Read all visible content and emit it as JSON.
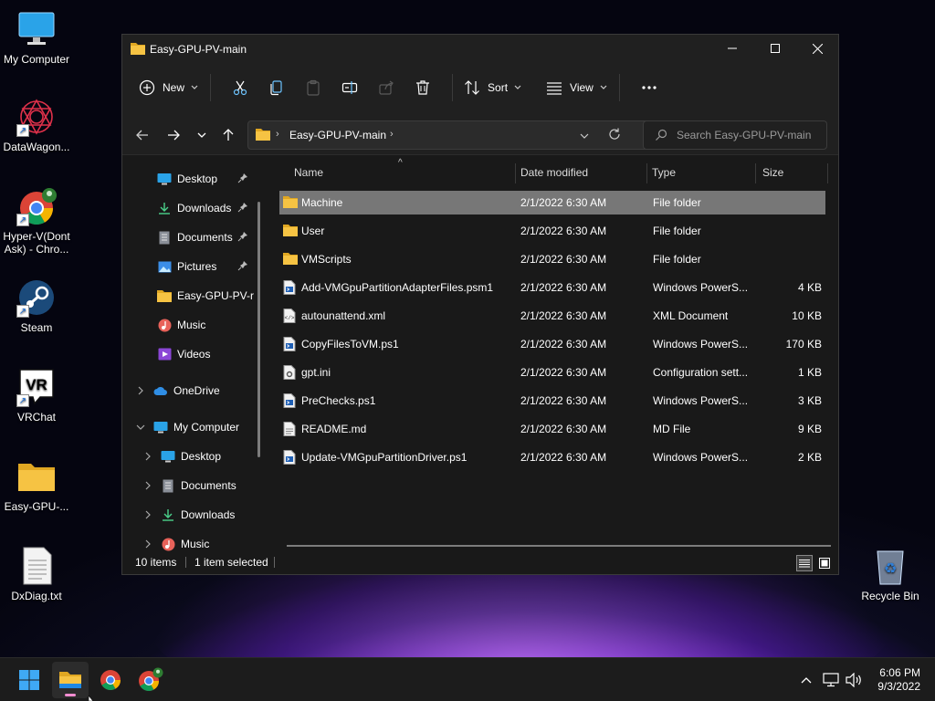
{
  "desktop": {
    "icons": [
      {
        "label": "My Computer"
      },
      {
        "label": "DataWagon..."
      },
      {
        "label": "Hyper-V(Dont Ask) - Chro..."
      },
      {
        "label": "Steam"
      },
      {
        "label": "VRChat"
      },
      {
        "label": "Easy-GPU-..."
      },
      {
        "label": "DxDiag.txt"
      },
      {
        "label": "Recycle Bin"
      }
    ]
  },
  "window": {
    "title": "Easy-GPU-PV-main",
    "commands": {
      "new_label": "New",
      "sort_label": "Sort",
      "view_label": "View"
    },
    "address": {
      "crumb": "Easy-GPU-PV-main"
    },
    "search": {
      "placeholder": "Search Easy-GPU-PV-main"
    },
    "sidebar": {
      "items": [
        {
          "label": "Desktop",
          "icon": "desktop-icon",
          "pinned": true
        },
        {
          "label": "Downloads",
          "icon": "download-icon",
          "pinned": true
        },
        {
          "label": "Documents",
          "icon": "document-icon",
          "pinned": true
        },
        {
          "label": "Pictures",
          "icon": "picture-icon",
          "pinned": true
        },
        {
          "label": "Easy-GPU-PV-r",
          "icon": "folder-icon",
          "pinned": false
        },
        {
          "label": "Music",
          "icon": "music-icon",
          "pinned": false
        },
        {
          "label": "Videos",
          "icon": "video-icon",
          "pinned": false
        },
        {
          "label": "OneDrive",
          "icon": "cloud-icon",
          "pinned": false
        },
        {
          "label": "My Computer",
          "icon": "computer-icon",
          "pinned": false
        },
        {
          "label": "Desktop",
          "icon": "desktop-icon",
          "pinned": false
        },
        {
          "label": "Documents",
          "icon": "document-icon",
          "pinned": false
        },
        {
          "label": "Downloads",
          "icon": "download-icon",
          "pinned": false
        },
        {
          "label": "Music",
          "icon": "music-icon",
          "pinned": false
        }
      ]
    },
    "columns": {
      "name": "Name",
      "date": "Date modified",
      "type": "Type",
      "size": "Size"
    },
    "files": [
      {
        "name": "Machine",
        "date": "2/1/2022 6:30 AM",
        "type": "File folder",
        "size": "",
        "icon": "folder-icon",
        "selected": true
      },
      {
        "name": "User",
        "date": "2/1/2022 6:30 AM",
        "type": "File folder",
        "size": "",
        "icon": "folder-icon",
        "selected": false
      },
      {
        "name": "VMScripts",
        "date": "2/1/2022 6:30 AM",
        "type": "File folder",
        "size": "",
        "icon": "folder-icon",
        "selected": false
      },
      {
        "name": "Add-VMGpuPartitionAdapterFiles.psm1",
        "date": "2/1/2022 6:30 AM",
        "type": "Windows PowerS...",
        "size": "4 KB",
        "icon": "script-file-icon",
        "selected": false
      },
      {
        "name": "autounattend.xml",
        "date": "2/1/2022 6:30 AM",
        "type": "XML Document",
        "size": "10 KB",
        "icon": "xml-file-icon",
        "selected": false
      },
      {
        "name": "CopyFilesToVM.ps1",
        "date": "2/1/2022 6:30 AM",
        "type": "Windows PowerS...",
        "size": "170 KB",
        "icon": "script-file-icon",
        "selected": false
      },
      {
        "name": "gpt.ini",
        "date": "2/1/2022 6:30 AM",
        "type": "Configuration sett...",
        "size": "1 KB",
        "icon": "config-file-icon",
        "selected": false
      },
      {
        "name": "PreChecks.ps1",
        "date": "2/1/2022 6:30 AM",
        "type": "Windows PowerS...",
        "size": "3 KB",
        "icon": "script-file-icon",
        "selected": false
      },
      {
        "name": "README.md",
        "date": "2/1/2022 6:30 AM",
        "type": "MD File",
        "size": "9 KB",
        "icon": "text-file-icon",
        "selected": false
      },
      {
        "name": "Update-VMGpuPartitionDriver.ps1",
        "date": "2/1/2022 6:30 AM",
        "type": "Windows PowerS...",
        "size": "2 KB",
        "icon": "script-file-icon",
        "selected": false
      }
    ],
    "status": {
      "count": "10 items",
      "selected": "1 item selected"
    }
  },
  "taskbar": {
    "time": "6:06 PM",
    "date": "9/3/2022"
  },
  "colors": {
    "folder": "#f6c343",
    "accent": "#4cc2ff",
    "selected_row": "#777777"
  }
}
